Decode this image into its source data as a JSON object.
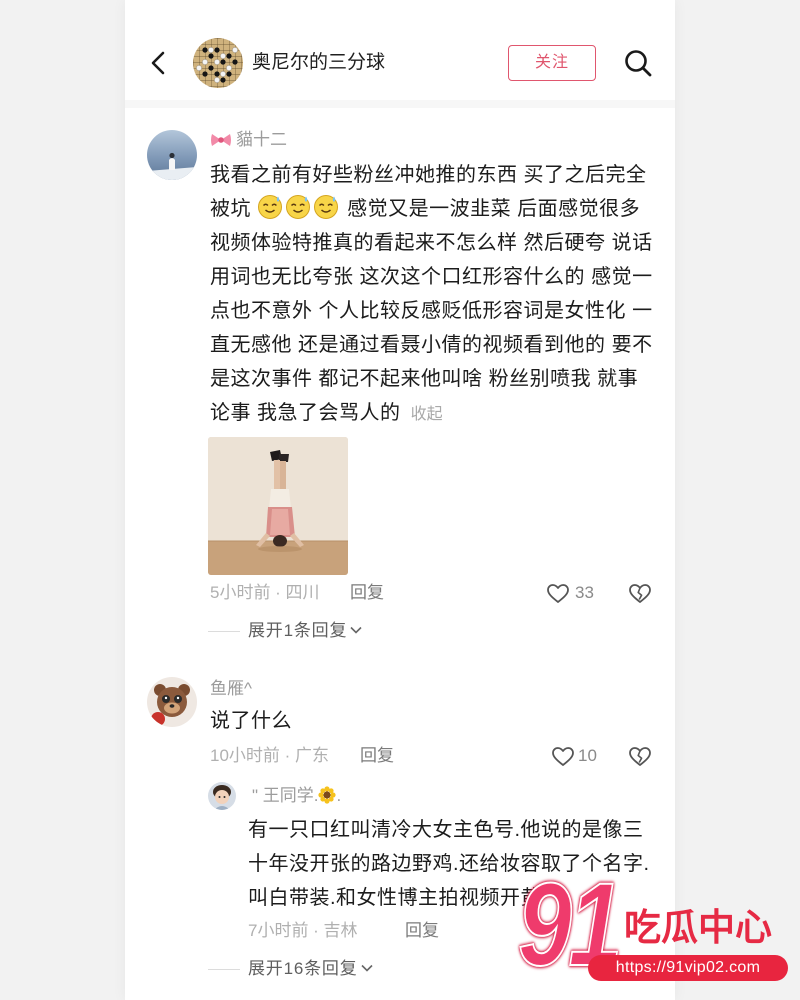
{
  "header": {
    "back_icon": "chevron-left-icon",
    "account_name": "奥尼尔的三分球",
    "follow_label": "关注",
    "search_icon": "search-icon"
  },
  "colors": {
    "accent": "#e0566e",
    "text": "#1c1c1c",
    "muted": "#b0b0b0",
    "watermark_red": "#e8253f"
  },
  "comments": [
    {
      "name_badge_icon": "bow-emoji",
      "username": "貓十二",
      "lines": [
        {
          "text": "我看之前有好些粉丝冲她推的东西 买了之后完全"
        },
        {
          "text": "被坑",
          "emojis": [
            "sweat-smile-emoji",
            "sweat-smile-emoji",
            "sweat-smile-emoji"
          ],
          "text_after": "感觉又是一波韭菜 后面感觉很多"
        },
        {
          "text": "视频体验特推真的看起来不怎么样 然后硬夸 说话"
        },
        {
          "text": "用词也无比夸张 这次这个口红形容什么的 感觉一"
        },
        {
          "text": "点也不意外 个人比较反感贬低形容词是女性化 一"
        },
        {
          "text": "直无感他 还是通过看聂小倩的视频看到他的 要不"
        },
        {
          "text": "是这次事件 都记不起来他叫啥 粉丝别喷我 就事"
        },
        {
          "text": "论事 我急了会骂人的",
          "collapse_label": "收起"
        }
      ],
      "time_location": "5小时前 · 四川",
      "reply_label": "回复",
      "like_icon": "heart-outline-icon",
      "like_count": "33",
      "dislike_icon": "broken-heart-icon",
      "expand_label": "展开1条回复",
      "expand_icon": "chevron-down-icon"
    },
    {
      "username": "鱼雁^",
      "lines": [
        {
          "text": "说了什么"
        }
      ],
      "time_location": "10小时前 · 广东",
      "reply_label": "回复",
      "like_icon": "heart-outline-icon",
      "like_count": "10",
      "dislike_icon": "broken-heart-icon",
      "replies": [
        {
          "username": "\" 王同学.",
          "name_emoji_icon": "sunflower-emoji",
          "username_suffix": ".",
          "lines": [
            {
              "text": "有一只口红叫清冷大女主色号.他说的是像三"
            },
            {
              "text": "十年没开张的路边野鸡.还给妆容取了个名字."
            },
            {
              "text": "叫白带装.和女性博主拍视频开黄"
            }
          ],
          "time_location": "7小时前 · 吉林",
          "reply_label": "回复"
        }
      ],
      "expand_label": "展开16条回复",
      "expand_icon": "chevron-down-icon"
    }
  ],
  "watermark": {
    "logo_number": "91",
    "logo_text": "吃瓜中心",
    "url": "https://91vip02.com"
  }
}
